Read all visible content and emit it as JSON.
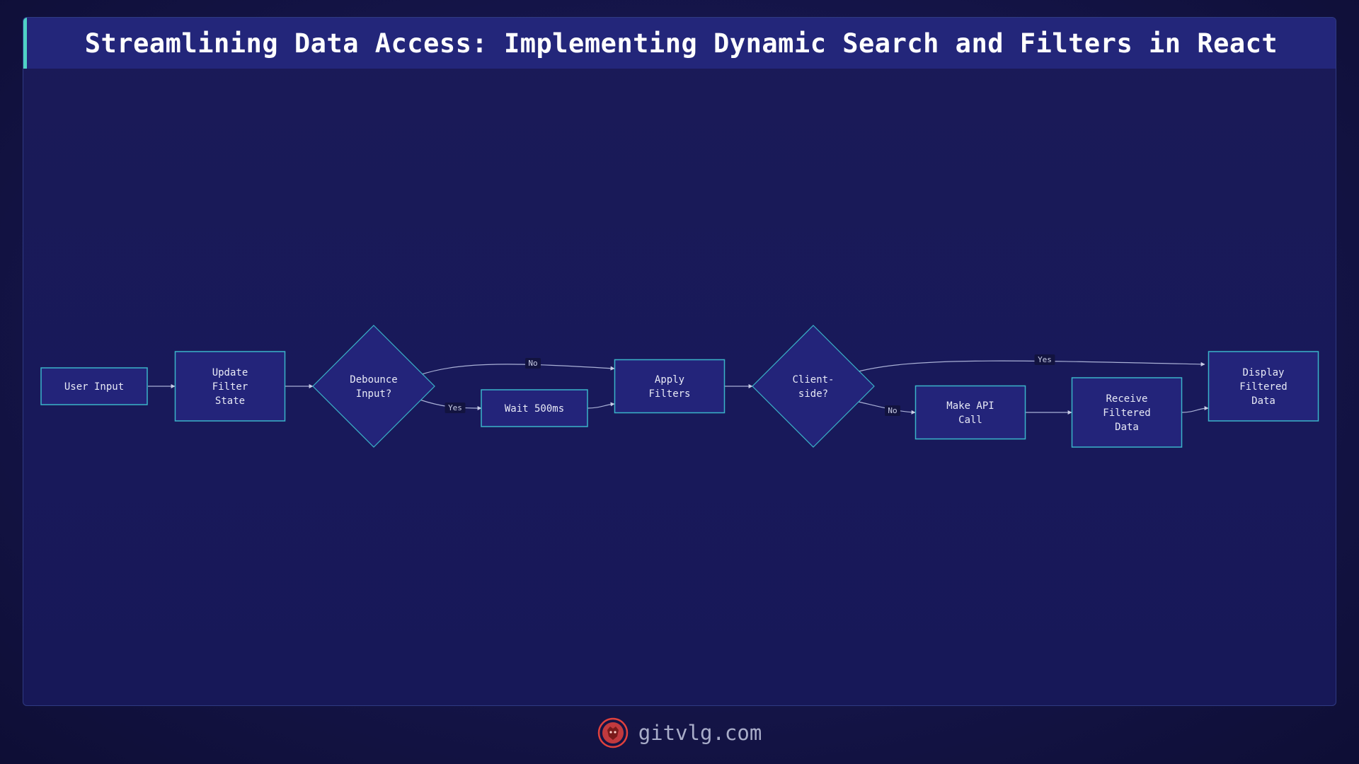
{
  "title": "Streamlining Data Access: Implementing Dynamic Search and Filters in React",
  "footer": {
    "site": "gitvlg.com",
    "logo_icon": "lion-icon"
  },
  "colors": {
    "accent": "#4fd1c5",
    "node_fill": "#23247a",
    "node_stroke": "#3ab4c9",
    "logo": "#e0413d"
  },
  "nodes": [
    {
      "id": "user_input",
      "shape": "rect",
      "lines": [
        "User Input"
      ]
    },
    {
      "id": "update_filter_state",
      "shape": "rect",
      "lines": [
        "Update",
        "Filter",
        "State"
      ]
    },
    {
      "id": "debounce_input",
      "shape": "diamond",
      "lines": [
        "Debounce",
        "Input?"
      ]
    },
    {
      "id": "wait_500ms",
      "shape": "rect",
      "lines": [
        "Wait 500ms"
      ]
    },
    {
      "id": "apply_filters",
      "shape": "rect",
      "lines": [
        "Apply",
        "Filters"
      ]
    },
    {
      "id": "client_side",
      "shape": "diamond",
      "lines": [
        "Client-",
        "side?"
      ]
    },
    {
      "id": "make_api_call",
      "shape": "rect",
      "lines": [
        "Make API",
        "Call"
      ]
    },
    {
      "id": "receive_filtered_data",
      "shape": "rect",
      "lines": [
        "Receive",
        "Filtered",
        "Data"
      ]
    },
    {
      "id": "display_filtered_data",
      "shape": "rect",
      "lines": [
        "Display",
        "Filtered",
        "Data"
      ]
    }
  ],
  "edges": [
    {
      "from": "user_input",
      "to": "update_filter_state",
      "label": ""
    },
    {
      "from": "update_filter_state",
      "to": "debounce_input",
      "label": ""
    },
    {
      "from": "debounce_input",
      "to": "apply_filters",
      "label": "No"
    },
    {
      "from": "debounce_input",
      "to": "wait_500ms",
      "label": "Yes"
    },
    {
      "from": "wait_500ms",
      "to": "apply_filters",
      "label": ""
    },
    {
      "from": "apply_filters",
      "to": "client_side",
      "label": ""
    },
    {
      "from": "client_side",
      "to": "display_filtered_data",
      "label": "Yes"
    },
    {
      "from": "client_side",
      "to": "make_api_call",
      "label": "No"
    },
    {
      "from": "make_api_call",
      "to": "receive_filtered_data",
      "label": ""
    },
    {
      "from": "receive_filtered_data",
      "to": "display_filtered_data",
      "label": ""
    }
  ]
}
